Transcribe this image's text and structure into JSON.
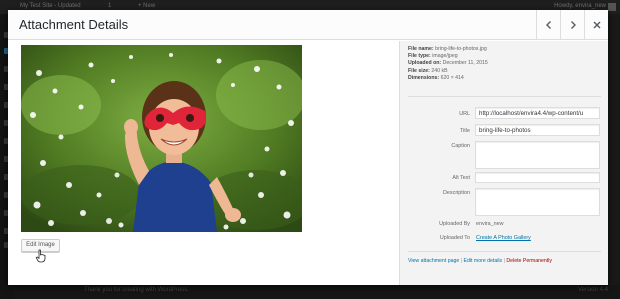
{
  "admin_bar": {
    "site": "My Test Site - Updated",
    "updates": "1",
    "new_label": "+ New",
    "howdy": "Howdy, envira_new"
  },
  "footer": {
    "thanks": "Thank you for creating with WordPress.",
    "version": "Version 4.4"
  },
  "modal": {
    "title": "Attachment Details",
    "edit_image_label": "Edit Image"
  },
  "meta": {
    "file_name_label": "File name:",
    "file_name": "bring-life-to-photos.jpg",
    "file_type_label": "File type:",
    "file_type": "image/jpeg",
    "uploaded_on_label": "Uploaded on:",
    "uploaded_on": "December 11, 2015",
    "file_size_label": "File size:",
    "file_size": "240 kB",
    "dimensions_label": "Dimensions:",
    "dimensions": "620 × 414"
  },
  "fields": {
    "url_label": "URL",
    "url_value": "http://localhost/envira4.4/wp-content/u",
    "title_label": "Title",
    "title_value": "bring-life-to-photos",
    "caption_label": "Caption",
    "caption_value": "",
    "alt_label": "Alt Text",
    "alt_value": "",
    "description_label": "Description",
    "description_value": "",
    "uploaded_by_label": "Uploaded By",
    "uploaded_by_value": "envira_new",
    "uploaded_to_label": "Uploaded To",
    "uploaded_to_value": "Create A Photo Gallery"
  },
  "actions": {
    "view": "View attachment page",
    "sep": "|",
    "edit_more": "Edit more details",
    "delete": "Delete Permanently"
  },
  "icons": {
    "prev": "chevron-left-icon",
    "next": "chevron-right-icon",
    "close": "close-icon",
    "cursor": "hand-pointer-cursor-icon"
  },
  "colors": {
    "link": "#0073aa",
    "delete": "#a00000",
    "sidebar_bg": "#f3f3f3"
  }
}
